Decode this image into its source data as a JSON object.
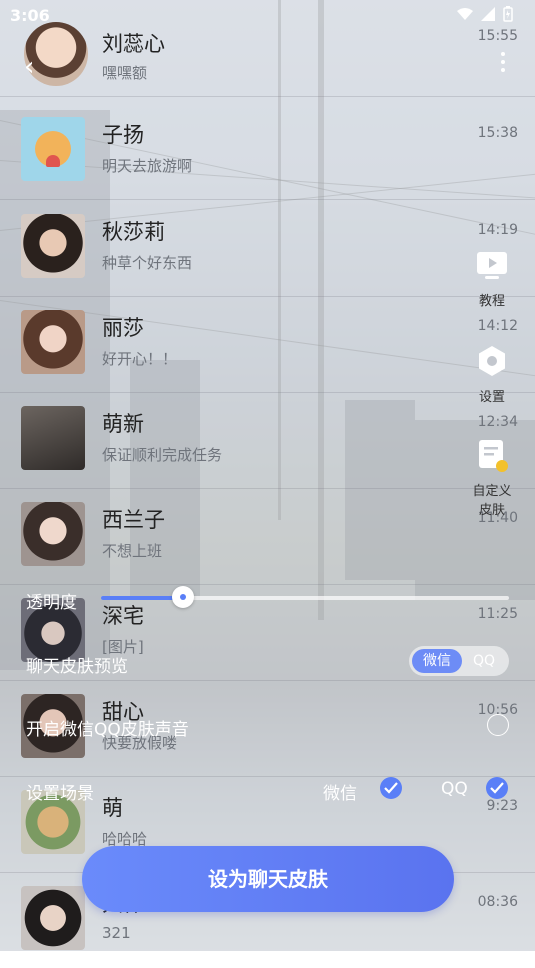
{
  "status_bar": {
    "time": "3:06"
  },
  "contacts": [
    {
      "name": "刘蕊心",
      "message": "嘿嘿额",
      "time": "15:55"
    },
    {
      "name": "子扬",
      "message": "明天去旅游啊",
      "time": "15:38"
    },
    {
      "name": "秋莎莉",
      "message": "种草个好东西",
      "time": "14:19"
    },
    {
      "name": "丽莎",
      "message": "好开心！！",
      "time": "14:12"
    },
    {
      "name": "萌新",
      "message": "保证顺利完成任务",
      "time": "12:34"
    },
    {
      "name": "西兰子",
      "message": "不想上班",
      "time": "11:40"
    },
    {
      "name": "深宅",
      "message": "[图片]",
      "time": "11:25"
    },
    {
      "name": "甜心",
      "message": "快要放假喽",
      "time": "10:56"
    },
    {
      "name": "萌",
      "message": "哈哈哈",
      "time": "9:23"
    },
    {
      "name": "大伟",
      "message": "321",
      "time": "08:36"
    }
  ],
  "side_buttons": {
    "tutorial": "教程",
    "settings": "设置",
    "custom_skin_1": "自定义",
    "custom_skin_2": "皮肤"
  },
  "controls": {
    "opacity_label": "透明度",
    "opacity_value": 0.2,
    "preview_label": "聊天皮肤预览",
    "preview_options": [
      "微信",
      "QQ"
    ],
    "preview_selected": "微信",
    "sound_label": "开启微信QQ皮肤声音",
    "sound_enabled": false,
    "scene_label": "设置场景",
    "scene_wechat": "微信",
    "scene_qq": "QQ",
    "scene_wechat_checked": true,
    "scene_qq_checked": true
  },
  "cta_label": "设为聊天皮肤",
  "colors": {
    "accent": "#5a7ff7",
    "accent_light": "#6d8cf6"
  }
}
